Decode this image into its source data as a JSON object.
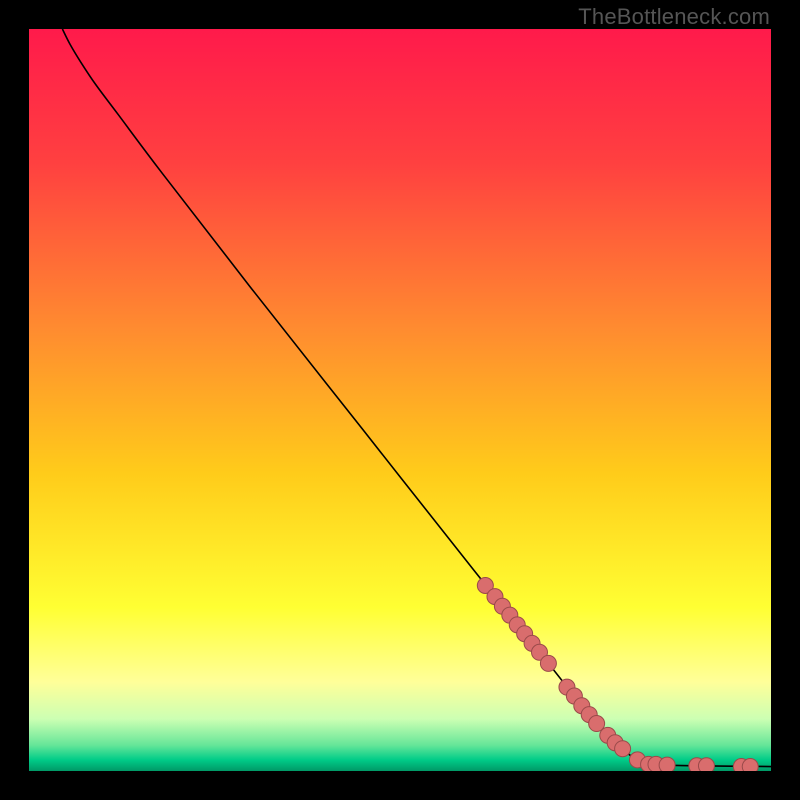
{
  "watermark": "TheBottleneck.com",
  "chart_data": {
    "type": "line",
    "title": "",
    "xlabel": "",
    "ylabel": "",
    "xlim": [
      0,
      100
    ],
    "ylim": [
      0,
      100
    ],
    "background_gradient_stops": [
      {
        "offset": 0,
        "color": "#ff1a4b"
      },
      {
        "offset": 0.18,
        "color": "#ff4040"
      },
      {
        "offset": 0.4,
        "color": "#ff8a30"
      },
      {
        "offset": 0.6,
        "color": "#ffcc1a"
      },
      {
        "offset": 0.78,
        "color": "#ffff33"
      },
      {
        "offset": 0.88,
        "color": "#ffff99"
      },
      {
        "offset": 0.93,
        "color": "#ccffb3"
      },
      {
        "offset": 0.965,
        "color": "#66e699"
      },
      {
        "offset": 0.985,
        "color": "#00cc88"
      },
      {
        "offset": 1.0,
        "color": "#009966"
      }
    ],
    "curve": [
      {
        "x": 4.5,
        "y": 100.0
      },
      {
        "x": 5.5,
        "y": 98.0
      },
      {
        "x": 7.0,
        "y": 95.5
      },
      {
        "x": 9.0,
        "y": 92.5
      },
      {
        "x": 12.0,
        "y": 88.5
      },
      {
        "x": 18.0,
        "y": 80.5
      },
      {
        "x": 30.0,
        "y": 65.0
      },
      {
        "x": 45.0,
        "y": 46.0
      },
      {
        "x": 60.0,
        "y": 27.0
      },
      {
        "x": 70.0,
        "y": 14.5
      },
      {
        "x": 76.0,
        "y": 7.0
      },
      {
        "x": 80.0,
        "y": 3.0
      },
      {
        "x": 82.0,
        "y": 1.5
      },
      {
        "x": 84.0,
        "y": 0.9
      },
      {
        "x": 90.0,
        "y": 0.7
      },
      {
        "x": 100.0,
        "y": 0.6
      }
    ],
    "markers": [
      {
        "x": 61.5,
        "y": 25.0
      },
      {
        "x": 62.8,
        "y": 23.5
      },
      {
        "x": 63.8,
        "y": 22.2
      },
      {
        "x": 64.8,
        "y": 21.0
      },
      {
        "x": 65.8,
        "y": 19.7
      },
      {
        "x": 66.8,
        "y": 18.5
      },
      {
        "x": 67.8,
        "y": 17.2
      },
      {
        "x": 68.8,
        "y": 16.0
      },
      {
        "x": 70.0,
        "y": 14.5
      },
      {
        "x": 72.5,
        "y": 11.3
      },
      {
        "x": 73.5,
        "y": 10.1
      },
      {
        "x": 74.5,
        "y": 8.8
      },
      {
        "x": 75.5,
        "y": 7.6
      },
      {
        "x": 76.5,
        "y": 6.4
      },
      {
        "x": 78.0,
        "y": 4.8
      },
      {
        "x": 79.0,
        "y": 3.8
      },
      {
        "x": 80.0,
        "y": 3.0
      },
      {
        "x": 82.0,
        "y": 1.5
      },
      {
        "x": 83.5,
        "y": 0.9
      },
      {
        "x": 84.5,
        "y": 0.9
      },
      {
        "x": 86.0,
        "y": 0.8
      },
      {
        "x": 90.0,
        "y": 0.7
      },
      {
        "x": 91.3,
        "y": 0.7
      },
      {
        "x": 96.0,
        "y": 0.6
      },
      {
        "x": 97.2,
        "y": 0.6
      }
    ],
    "marker_style": {
      "radius_px": 8,
      "fill": "#d96d6d",
      "stroke": "#9a4a4a",
      "stroke_width": 1
    },
    "curve_style": {
      "stroke": "#000000",
      "stroke_width": 1.6
    }
  }
}
